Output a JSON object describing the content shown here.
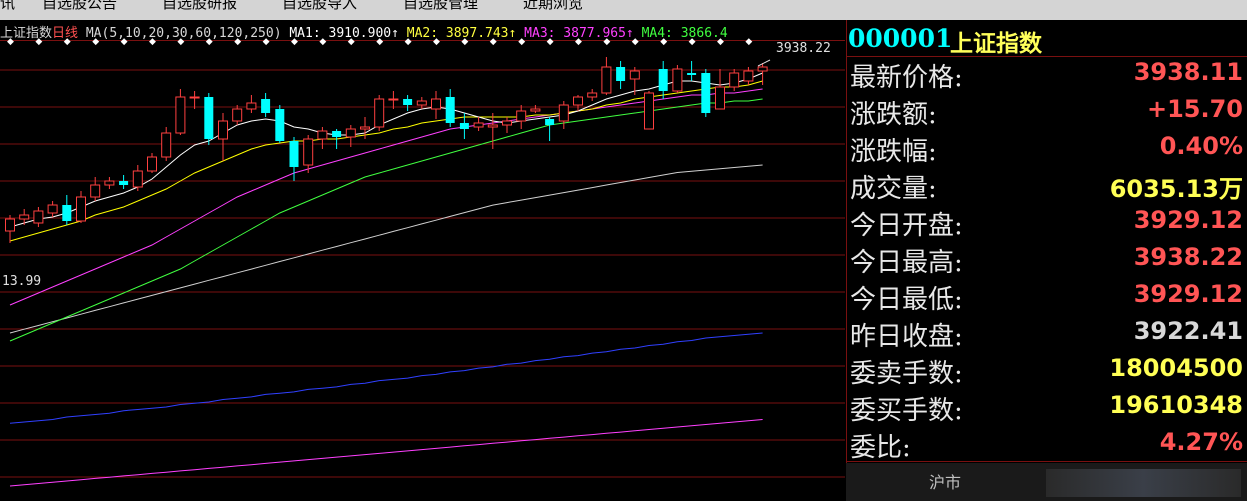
{
  "menu": [
    "讯",
    "自选股公告",
    "自选股研报",
    "自选股导入",
    "自选股管理",
    "近期浏览"
  ],
  "legend": {
    "title": "上证指数",
    "period": "日线",
    "ma_spec": "MA(5,10,20,30,60,120,250)",
    "ma1": "MA1: 3910.900↑",
    "ma2": "MA2: 3897.743↑",
    "ma3": "MA3: 3877.965↑",
    "ma4": "MA4: 3866.4"
  },
  "colors": {
    "up": "#ff4040",
    "down": "#00ffff",
    "ma1": "#ffffff",
    "ma2": "#ffff00",
    "ma3": "#ff40ff",
    "ma4": "#40ff40",
    "ma5": "#d0d0d0",
    "ma6": "#3040ff",
    "ma7": "#ff40ff",
    "grid": "#7a1010"
  },
  "chart_data": {
    "type": "candlestick",
    "high_label": "3938.22",
    "low_label": "13.99",
    "ylim": [
      3850,
      3950
    ],
    "candles": [
      {
        "o": 3777,
        "c": 3783,
        "h": 3785,
        "l": 3771
      },
      {
        "o": 3783,
        "c": 3785,
        "h": 3788,
        "l": 3780
      },
      {
        "o": 3781,
        "c": 3787,
        "h": 3789,
        "l": 3779
      },
      {
        "o": 3786,
        "c": 3790,
        "h": 3792,
        "l": 3784
      },
      {
        "o": 3790,
        "c": 3782,
        "h": 3795,
        "l": 3780
      },
      {
        "o": 3782,
        "c": 3794,
        "h": 3797,
        "l": 3781
      },
      {
        "o": 3794,
        "c": 3800,
        "h": 3804,
        "l": 3792
      },
      {
        "o": 3800,
        "c": 3802,
        "h": 3804,
        "l": 3798
      },
      {
        "o": 3802,
        "c": 3800,
        "h": 3805,
        "l": 3798
      },
      {
        "o": 3799,
        "c": 3807,
        "h": 3810,
        "l": 3797
      },
      {
        "o": 3807,
        "c": 3814,
        "h": 3816,
        "l": 3806
      },
      {
        "o": 3814,
        "c": 3826,
        "h": 3829,
        "l": 3812
      },
      {
        "o": 3826,
        "c": 3844,
        "h": 3848,
        "l": 3825
      },
      {
        "o": 3844,
        "c": 3844,
        "h": 3847,
        "l": 3838
      },
      {
        "o": 3844,
        "c": 3823,
        "h": 3846,
        "l": 3820
      },
      {
        "o": 3823,
        "c": 3832,
        "h": 3836,
        "l": 3812
      },
      {
        "o": 3832,
        "c": 3838,
        "h": 3840,
        "l": 3830
      },
      {
        "o": 3838,
        "c": 3841,
        "h": 3845,
        "l": 3836
      },
      {
        "o": 3843,
        "c": 3836,
        "h": 3846,
        "l": 3834
      },
      {
        "o": 3838,
        "c": 3822,
        "h": 3840,
        "l": 3821
      },
      {
        "o": 3822,
        "c": 3809,
        "h": 3824,
        "l": 3802
      },
      {
        "o": 3810,
        "c": 3823,
        "h": 3825,
        "l": 3806
      },
      {
        "o": 3823,
        "c": 3827,
        "h": 3829,
        "l": 3818
      },
      {
        "o": 3827,
        "c": 3824,
        "h": 3828,
        "l": 3818
      },
      {
        "o": 3824,
        "c": 3828,
        "h": 3830,
        "l": 3819
      },
      {
        "o": 3828,
        "c": 3829,
        "h": 3834,
        "l": 3823
      },
      {
        "o": 3829,
        "c": 3843,
        "h": 3845,
        "l": 3827
      },
      {
        "o": 3843,
        "c": 3843,
        "h": 3847,
        "l": 3838
      },
      {
        "o": 3843,
        "c": 3840,
        "h": 3845,
        "l": 3837
      },
      {
        "o": 3840,
        "c": 3842,
        "h": 3844,
        "l": 3838
      },
      {
        "o": 3838,
        "c": 3843,
        "h": 3847,
        "l": 3833
      },
      {
        "o": 3844,
        "c": 3831,
        "h": 3848,
        "l": 3829
      },
      {
        "o": 3831,
        "c": 3828,
        "h": 3836,
        "l": 3823
      },
      {
        "o": 3829,
        "c": 3831,
        "h": 3834,
        "l": 3827
      },
      {
        "o": 3829,
        "c": 3830,
        "h": 3836,
        "l": 3818
      },
      {
        "o": 3830,
        "c": 3832,
        "h": 3834,
        "l": 3826
      },
      {
        "o": 3832,
        "c": 3837,
        "h": 3840,
        "l": 3828
      },
      {
        "o": 3837,
        "c": 3838,
        "h": 3840,
        "l": 3836
      },
      {
        "o": 3833,
        "c": 3830,
        "h": 3834,
        "l": 3822
      },
      {
        "o": 3832,
        "c": 3840,
        "h": 3842,
        "l": 3828
      },
      {
        "o": 3840,
        "c": 3844,
        "h": 3845,
        "l": 3837
      },
      {
        "o": 3844,
        "c": 3846,
        "h": 3848,
        "l": 3842
      },
      {
        "o": 3846,
        "c": 3859,
        "h": 3864,
        "l": 3845
      },
      {
        "o": 3859,
        "c": 3852,
        "h": 3862,
        "l": 3848
      },
      {
        "o": 3853,
        "c": 3857,
        "h": 3859,
        "l": 3845
      },
      {
        "o": 3828,
        "c": 3846,
        "h": 3847,
        "l": 3828
      },
      {
        "o": 3858,
        "c": 3847,
        "h": 3862,
        "l": 3843
      },
      {
        "o": 3847,
        "c": 3858,
        "h": 3860,
        "l": 3846
      },
      {
        "o": 3856,
        "c": 3855,
        "h": 3862,
        "l": 3852
      },
      {
        "o": 3856,
        "c": 3836,
        "h": 3858,
        "l": 3834
      },
      {
        "o": 3838,
        "c": 3849,
        "h": 3858,
        "l": 3838
      },
      {
        "o": 3849,
        "c": 3856,
        "h": 3858,
        "l": 3847
      },
      {
        "o": 3852,
        "c": 3857,
        "h": 3859,
        "l": 3850
      },
      {
        "o": 3857,
        "c": 3859,
        "h": 3861,
        "l": 3850
      }
    ],
    "ma1": [
      3779,
      3781,
      3783,
      3784,
      3786,
      3789,
      3792,
      3794,
      3796,
      3799,
      3803,
      3809,
      3815,
      3820,
      3822,
      3826,
      3830,
      3832,
      3833,
      3832,
      3829,
      3828,
      3826,
      3825,
      3825,
      3826,
      3830,
      3833,
      3836,
      3838,
      3839,
      3838,
      3836,
      3834,
      3832,
      3831,
      3832,
      3833,
      3834,
      3835,
      3837,
      3840,
      3843,
      3845,
      3847,
      3848,
      3850,
      3852,
      3852,
      3851,
      3850,
      3851,
      3853,
      3856
    ],
    "ma2": [
      3772,
      3774,
      3776,
      3778,
      3780,
      3782,
      3785,
      3787,
      3789,
      3792,
      3795,
      3798,
      3802,
      3806,
      3809,
      3812,
      3815,
      3818,
      3820,
      3821,
      3822,
      3822,
      3823,
      3823,
      3824,
      3825,
      3826,
      3828,
      3829,
      3831,
      3832,
      3833,
      3834,
      3834,
      3834,
      3834,
      3834,
      3835,
      3835,
      3836,
      3837,
      3838,
      3840,
      3841,
      3843,
      3844,
      3845,
      3846,
      3847,
      3848,
      3849,
      3849,
      3850,
      3852
    ],
    "ma3": [
      3740,
      3743,
      3746,
      3749,
      3752,
      3755,
      3758,
      3761,
      3764,
      3767,
      3770,
      3774,
      3778,
      3782,
      3786,
      3790,
      3794,
      3797,
      3800,
      3803,
      3806,
      3808,
      3810,
      3812,
      3814,
      3816,
      3818,
      3820,
      3822,
      3824,
      3826,
      3828,
      3829,
      3830,
      3831,
      3832,
      3833,
      3834,
      3835,
      3836,
      3837,
      3838,
      3839,
      3840,
      3841,
      3842,
      3843,
      3844,
      3845,
      3845,
      3846,
      3846,
      3847,
      3848
    ],
    "ma4": [
      3722,
      3725,
      3728,
      3731,
      3734,
      3737,
      3740,
      3743,
      3746,
      3749,
      3752,
      3755,
      3758,
      3762,
      3766,
      3770,
      3774,
      3778,
      3782,
      3786,
      3789,
      3792,
      3795,
      3798,
      3801,
      3804,
      3806,
      3808,
      3810,
      3812,
      3814,
      3816,
      3818,
      3820,
      3822,
      3824,
      3826,
      3828,
      3830,
      3831,
      3832,
      3833,
      3834,
      3835,
      3836,
      3837,
      3838,
      3839,
      3840,
      3841,
      3841,
      3842,
      3842,
      3843
    ],
    "ma5": [
      3670,
      3673,
      3676,
      3679,
      3682,
      3685,
      3688,
      3691,
      3694,
      3697,
      3700,
      3703,
      3706,
      3709,
      3712,
      3715,
      3718,
      3721,
      3724,
      3727,
      3730,
      3733,
      3736,
      3739,
      3742,
      3745,
      3748,
      3751,
      3754,
      3757,
      3760,
      3763,
      3766,
      3769,
      3772,
      3774,
      3776,
      3778,
      3780,
      3782,
      3784,
      3786,
      3788,
      3790,
      3792,
      3794,
      3796,
      3798,
      3799,
      3800,
      3801,
      3802,
      3803,
      3804
    ],
    "ma6": [
      3598,
      3599,
      3600,
      3601,
      3603,
      3604,
      3605,
      3606,
      3608,
      3609,
      3610,
      3611,
      3613,
      3614,
      3615,
      3617,
      3618,
      3619,
      3621,
      3622,
      3623,
      3625,
      3626,
      3627,
      3629,
      3630,
      3632,
      3633,
      3634,
      3636,
      3637,
      3639,
      3640,
      3642,
      3643,
      3645,
      3646,
      3648,
      3649,
      3651,
      3652,
      3654,
      3655,
      3657,
      3658,
      3660,
      3661,
      3663,
      3664,
      3666,
      3667,
      3668,
      3669,
      3670
    ],
    "ma7": [
      3548,
      3549,
      3550,
      3551,
      3552,
      3553,
      3554,
      3555,
      3556,
      3557,
      3558,
      3559,
      3560,
      3561,
      3562,
      3563,
      3564,
      3565,
      3566,
      3567,
      3568,
      3569,
      3570,
      3571,
      3572,
      3573,
      3574,
      3575,
      3576,
      3577,
      3578,
      3579,
      3580,
      3581,
      3582,
      3583,
      3584,
      3585,
      3586,
      3587,
      3588,
      3589,
      3590,
      3591,
      3592,
      3593,
      3594,
      3595,
      3596,
      3597,
      3598,
      3599,
      3600,
      3601
    ]
  },
  "panel": {
    "code": "000001",
    "name": "上证指数",
    "rows": [
      {
        "label": "最新价格:",
        "value": "3938.11",
        "color": "#ff5555"
      },
      {
        "label": "涨跌额:",
        "value": "+15.70",
        "color": "#ff5555"
      },
      {
        "label": "涨跌幅:",
        "value": "0.40%",
        "color": "#ff5555"
      },
      {
        "label": "成交量:",
        "value": "6035.13万",
        "color": "#ffff55"
      },
      {
        "label": "今日开盘:",
        "value": "3929.12",
        "color": "#ff5555"
      },
      {
        "label": "今日最高:",
        "value": "3938.22",
        "color": "#ff5555"
      },
      {
        "label": "今日最低:",
        "value": "3929.12",
        "color": "#ff5555"
      },
      {
        "label": "昨日收盘:",
        "value": "3922.41",
        "color": "#d8d8d8"
      },
      {
        "label": "委卖手数:",
        "value": "18004500",
        "color": "#ffff55"
      },
      {
        "label": "委买手数:",
        "value": "19610348",
        "color": "#ffff55"
      },
      {
        "label": "委比:",
        "value": "4.27%",
        "color": "#ff5555"
      }
    ],
    "tabs": [
      "沪市"
    ]
  }
}
